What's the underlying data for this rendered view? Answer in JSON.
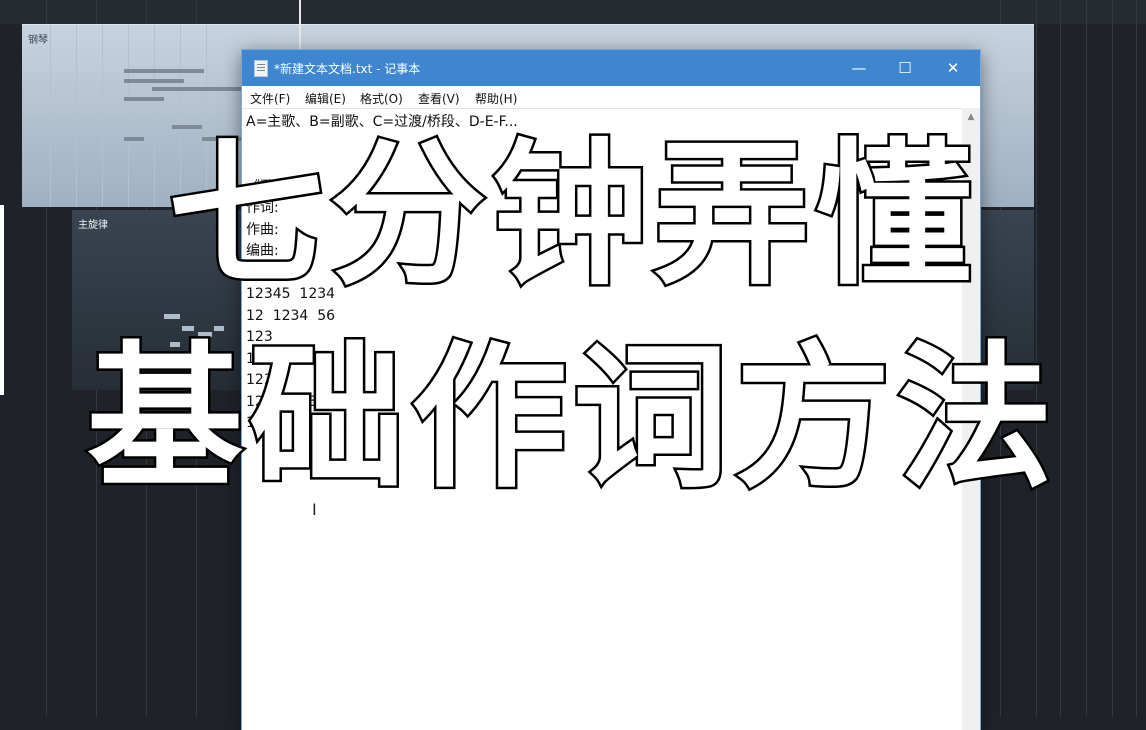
{
  "daw": {
    "track_piano": "钢琴",
    "track_melody": "主旋律"
  },
  "notepad": {
    "title": "*新建文本文档.txt - 记事本",
    "window_controls": {
      "minimize": "—",
      "maximize": "☐",
      "close": "✕"
    },
    "menu": [
      "文件(F)",
      "编辑(E)",
      "格式(O)",
      "查看(V)",
      "帮助(H)"
    ],
    "lines": [
      "A=主歌、B=副歌、C=过渡/桥段、D-E-F...",
      "",
      "",
      "《歌名》",
      "作词:",
      "作曲:",
      "编曲:",
      "A1",
      "12345  1234",
      "12  1234  56",
      "123",
      "12",
      "1234",
      "1234  123",
      "1234"
    ]
  },
  "overlay": {
    "line1": "七分钟弄懂",
    "line2": "基础作词方法"
  },
  "colors": {
    "titlebar": "#3f86d0",
    "daw_background": "#1f2329",
    "piano_lane": "#b4c2d1"
  }
}
